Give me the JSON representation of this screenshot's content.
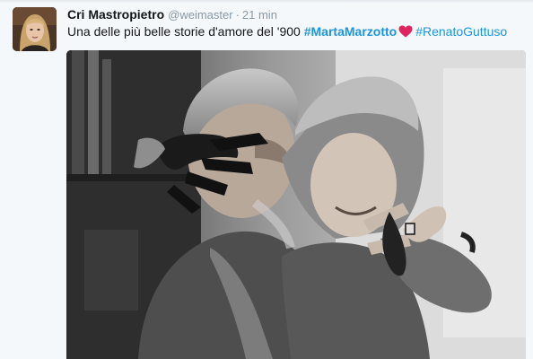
{
  "tweet": {
    "display_name": "Cri Mastropietro",
    "handle": "@weimaster",
    "separator": "·",
    "timestamp": "21 min",
    "text_plain": "Una delle più belle storie d'amore del '900 ",
    "hashtag_1": "#MartaMarzotto",
    "hashtag_2": "#RenatoGuttuso",
    "emoji": "heart-icon"
  },
  "colors": {
    "background": "#f5f8fa",
    "text": "#14171a",
    "muted": "#8899a6",
    "hashtag": "#1b95e0",
    "heart": "#e0245e"
  }
}
